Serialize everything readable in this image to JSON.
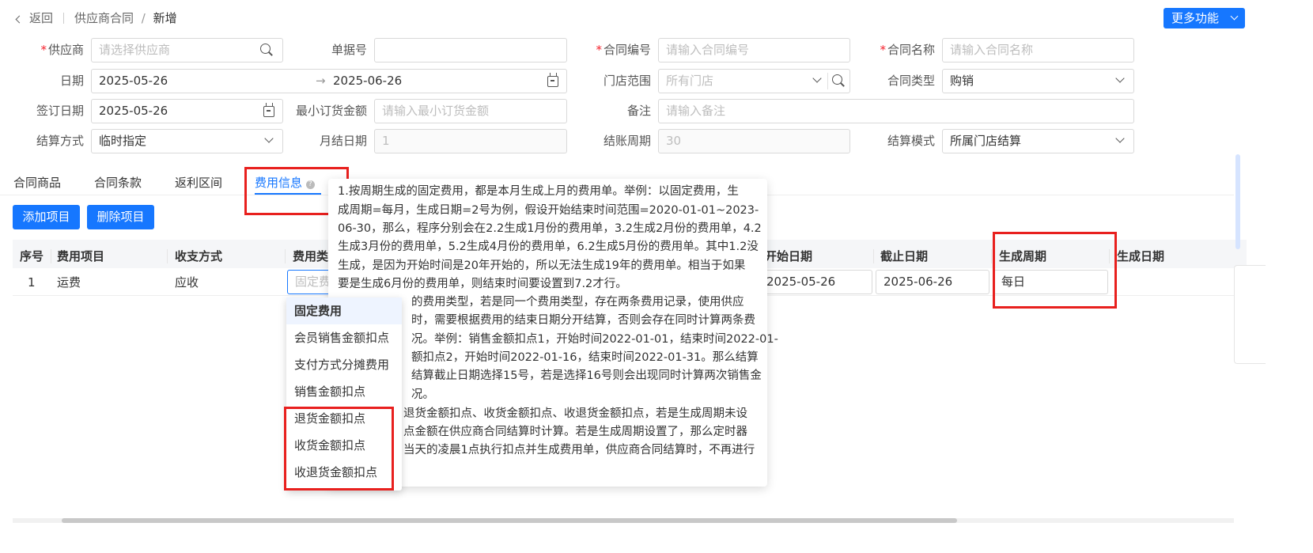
{
  "header": {
    "back": "返回",
    "breadcrumb_parent": "供应商合同",
    "breadcrumb_sep": "/",
    "breadcrumb_current": "新增",
    "more_button": "更多功能"
  },
  "form": {
    "supplier_label": "供应商",
    "supplier_placeholder": "请选择供应商",
    "docno_label": "单据号",
    "contract_no_label": "合同编号",
    "contract_no_placeholder": "请输入合同编号",
    "contract_name_label": "合同名称",
    "contract_name_placeholder": "请输入合同名称",
    "date_label": "日期",
    "date_start": "2025-05-26",
    "date_arrow": "→",
    "date_end": "2025-06-26",
    "store_label": "门店范围",
    "store_placeholder": "所有门店",
    "type_label": "合同类型",
    "type_value": "购销",
    "sign_label": "签订日期",
    "sign_value": "2025-05-26",
    "min_label": "最小订货金额",
    "min_placeholder": "请输入最小订货金额",
    "remark_label": "备注",
    "remark_placeholder": "请输入备注",
    "settle_label": "结算方式",
    "settle_value": "临时指定",
    "month_label": "月结日期",
    "month_value": "1",
    "cycle_label": "结账周期",
    "cycle_value": "30",
    "mode_label": "结算模式",
    "mode_value": "所属门店结算"
  },
  "tabs": [
    "合同商品",
    "合同条款",
    "返利区间",
    "费用信息"
  ],
  "tab_help_icon": "question-icon",
  "actions": {
    "add": "添加项目",
    "delete": "删除项目"
  },
  "table": {
    "headers": [
      "序号",
      "费用项目",
      "收支方式",
      "费用类",
      "开始日期",
      "截止日期",
      "生成周期",
      "生成日期"
    ],
    "row": {
      "index": "1",
      "item": "运费",
      "mode": "应收",
      "type_placeholder": "固定费",
      "start": "2025-05-26",
      "end": "2025-06-26",
      "cycle": "每日"
    }
  },
  "dropdown": {
    "header": "固定费用",
    "items": [
      "会员销售金额扣点",
      "支付方式分摊费用",
      "销售金额扣点",
      "退货金额扣点",
      "收货金额扣点",
      "收退货金额扣点"
    ]
  },
  "tooltip": {
    "lines": [
      "1.按周期生成的固定费用，都是本月生成上月的费用单。举例：以固定费用，生",
      "成周期=每月，生成日期=2号为例，假设开始结束时间范围=2020-01-01~2023-",
      "06-30，那么，程序分别会在2.2生成1月份的费用单，3.2生成2月份的费用单，4.2",
      "生成3月份的费用单，5.2生成4月份的费用单，6.2生成5月份的费用单。其中1.2没",
      "生成，是因为开始时间是20年开始的，所以无法生成19年的费用单。相当于如果",
      "要是生成6月份的费用单，则结束时间要设置到7.2才行。",
      "的费用类型，若是同一个费用类型，存在两条费用记录，使用供应",
      "时，需要根据费用的结束日期分开结算，否则会存在同时计算两条费",
      "况。举例：销售金额扣点1，开始时间2022-01-01，结束时间2022-01-",
      "额扣点2，开始时间2022-01-16，结束时间2022-01-31。那么结算",
      "结算截止日期选择15号，若是选择16号则会出现同时计算两次销售金",
      "况。",
      "退货金额扣点、收货金额扣点、收退货金额扣点，若是生成周期未设",
      "点金额在供应商合同结算时计算。若是生成周期设置了，那么定时器",
      "当天的凌晨1点执行扣点并生成费用单，供应商合同结算时，不再进行"
    ]
  }
}
